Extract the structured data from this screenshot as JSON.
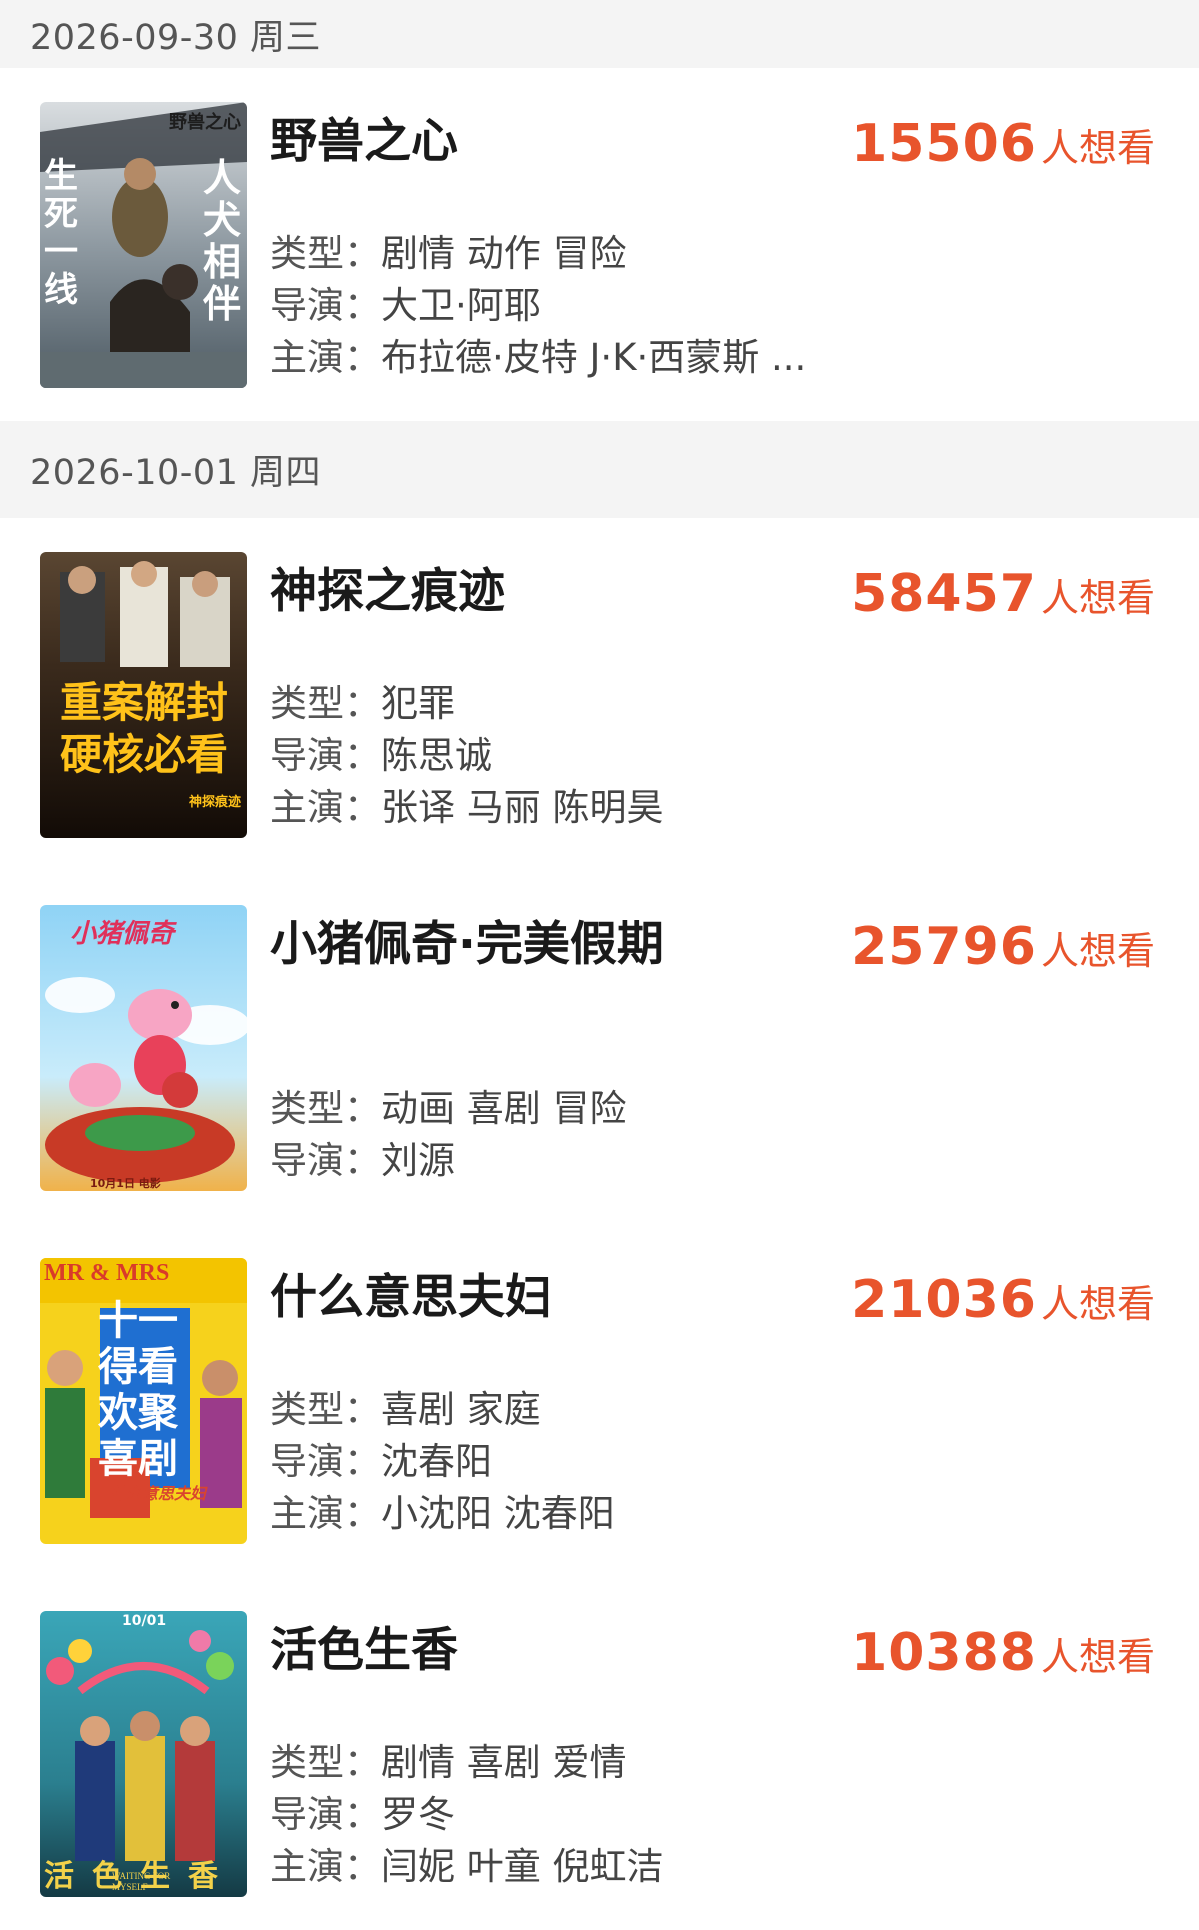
{
  "want_suffix": "人想看",
  "labels": {
    "genre": "类型：",
    "director": "导演：",
    "cast": "主演："
  },
  "groups": [
    {
      "date": "2026-09-30 周三",
      "movies": [
        {
          "title": "野兽之心",
          "want_count": "15506",
          "genre": "剧情 动作 冒险",
          "director": "大卫·阿耶",
          "cast": "布拉德·皮特 J·K·西蒙斯 ...",
          "poster": {
            "theme": "dog-soldier",
            "text_top": "野兽之心",
            "text_left": "生死一线",
            "text_right": "人犬相伴"
          }
        }
      ]
    },
    {
      "date": "2026-10-01 周四",
      "movies": [
        {
          "title": "神探之痕迹",
          "want_count": "58457",
          "genre": "犯罪",
          "director": "陈思诚",
          "cast": "张译 马丽 陈明昊",
          "poster": {
            "theme": "detective",
            "text_main": "重案解封硬核必看",
            "text_small": "神探痕迹"
          }
        },
        {
          "title": "小猪佩奇·完美假期",
          "want_count": "25796",
          "genre": "动画 喜剧 冒险",
          "director": "刘源",
          "cast": "",
          "poster": {
            "theme": "peppa",
            "text_main": "小猪佩奇",
            "text_small": "10月1日 电影"
          }
        },
        {
          "title": "什么意思夫妇",
          "want_count": "21036",
          "genre": "喜剧 家庭",
          "director": "沈春阳",
          "cast": "小沈阳 沈春阳",
          "poster": {
            "theme": "comedy",
            "text_main": "十一得看欢聚喜剧",
            "text_small": "什么意思夫妇",
            "text_top": "MR & MRS"
          }
        },
        {
          "title": "活色生香",
          "want_count": "10388",
          "genre": "剧情 喜剧 爱情",
          "director": "罗冬",
          "cast": "闫妮 叶童 倪虹洁",
          "poster": {
            "theme": "festive",
            "text_main": "活色生香",
            "text_top": "10/01",
            "text_small": "WAITING FOR MYSELF"
          }
        }
      ]
    }
  ]
}
